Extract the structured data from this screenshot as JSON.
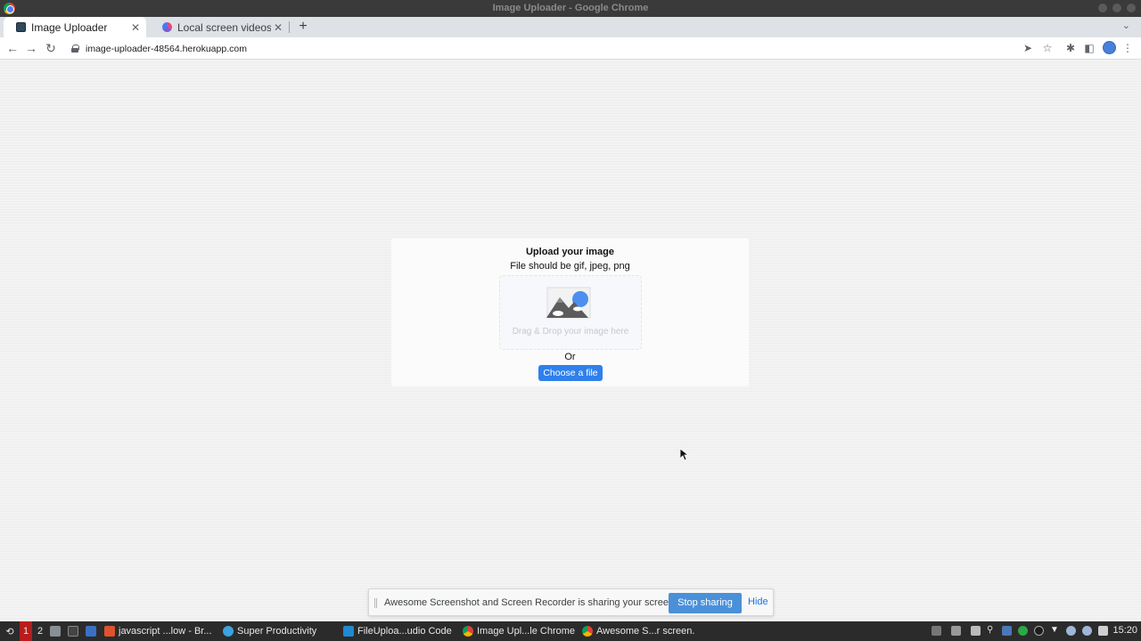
{
  "window": {
    "title": "Image Uploader - Google Chrome"
  },
  "tabs": [
    {
      "label": "Image Uploader",
      "active": true
    },
    {
      "label": "Local screen videos",
      "active": false
    }
  ],
  "toolbar": {
    "url": "image-uploader-48564.herokuapp.com"
  },
  "uploader": {
    "title": "Upload your image",
    "subtitle": "File should be gif, jpeg, png",
    "drop_text": "Drag & Drop your image here",
    "or_text": "Or",
    "choose_label": "Choose a file"
  },
  "share_bar": {
    "message": "Awesome Screenshot and Screen Recorder is sharing your screen.",
    "stop_label": "Stop sharing",
    "hide_label": "Hide"
  },
  "taskbar": {
    "workspaces": [
      "1",
      "2"
    ],
    "items": [
      {
        "label": "javascript ...low - Br...",
        "icon": "brave-icon"
      },
      {
        "label": "Super Productivity",
        "icon": "super-productivity-icon"
      },
      {
        "label": "FileUploa...udio Code",
        "icon": "vscode-icon"
      },
      {
        "label": "Image Upl...le Chrome",
        "icon": "chrome-icon"
      },
      {
        "label": "Awesome S...r screen.",
        "icon": "chrome-icon"
      }
    ],
    "clock": "15:20"
  },
  "colors": {
    "accent": "#2f80ed",
    "share_button": "#4a90d9",
    "taskbar_bg": "#2b2b2b"
  }
}
